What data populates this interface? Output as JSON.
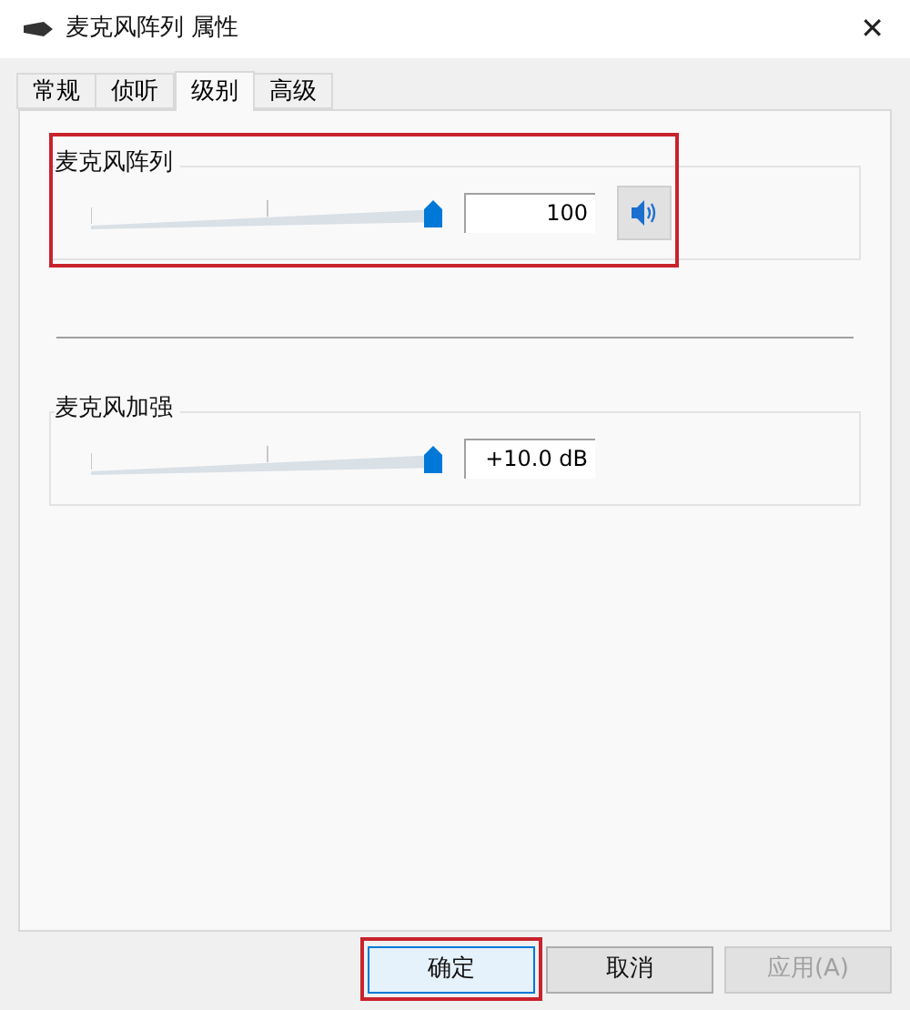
{
  "window": {
    "title": "麦克风阵列 属性",
    "close": "✕"
  },
  "tabs": [
    {
      "label": "常规",
      "selected": false
    },
    {
      "label": "侦听",
      "selected": false
    },
    {
      "label": "级别",
      "selected": true
    },
    {
      "label": "高级",
      "selected": false
    }
  ],
  "groups": [
    {
      "label": "麦克风阵列",
      "level": 1,
      "reading": "100",
      "highlighted": true,
      "speaker": {
        "muted": false
      }
    },
    {
      "label": "麦克风加强",
      "level": 1,
      "reading": "+10.0 dB",
      "highlighted": false
    }
  ],
  "buttons": [
    {
      "label": "确定",
      "kind": "default",
      "disabled": false,
      "highlighted": true
    },
    {
      "label": "取消",
      "kind": "normal",
      "disabled": false,
      "highlighted": false
    },
    {
      "label": "应用(A)",
      "kind": "normal",
      "disabled": true,
      "highlighted": false
    }
  ]
}
